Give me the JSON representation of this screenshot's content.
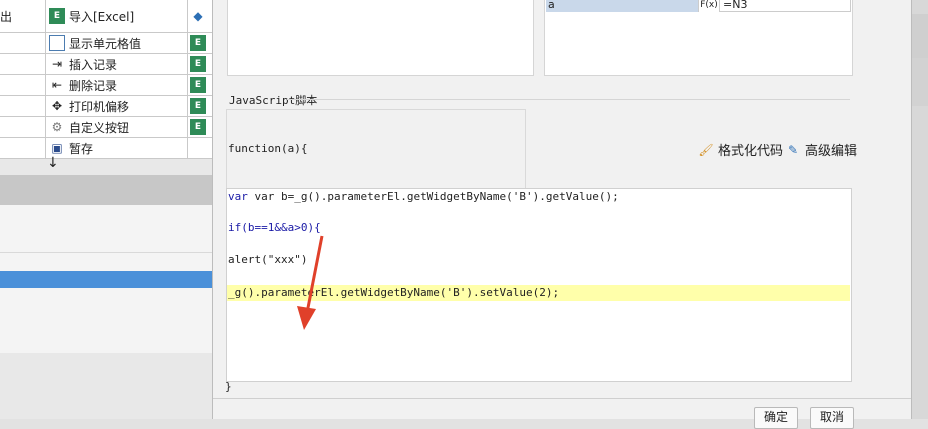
{
  "left_panel": {
    "rows": [
      {
        "c0": "出",
        "c1_icon": "import-excel-icon",
        "c1": "导入[Excel]",
        "c2": ""
      },
      {
        "c0": "",
        "c1_icon": "show-cell-icon",
        "c1": "显示单元格值",
        "c2": ""
      },
      {
        "c0": "",
        "c1_icon": "insert-record-icon",
        "c1": "插入记录",
        "c2": ""
      },
      {
        "c0": "",
        "c1_icon": "delete-record-icon",
        "c1": "删除记录",
        "c2": ""
      },
      {
        "c0": "",
        "c1_icon": "printer-offset-icon",
        "c1": "打印机偏移",
        "c2": ""
      },
      {
        "c0": "",
        "c1_icon": "gear-icon",
        "c1": "自定义按钮",
        "c2": ""
      },
      {
        "c0": "",
        "c1_icon": "save-icon",
        "c1": "暂存",
        "c2": ""
      }
    ]
  },
  "parameter_table": {
    "name": "a",
    "type": "F(x)",
    "value": "=N3"
  },
  "js_section": {
    "title": "JavaScript脚本",
    "signature": "function(a){",
    "format_label": "格式化代码",
    "advanced_label": "高级编辑",
    "closing": "}"
  },
  "code_lines": {
    "l1": "var b=_g().parameterEl.getWidgetByName('B').getValue();",
    "l2": "if(b==1&&a>0){",
    "l3": "alert(\"xxx\")",
    "l4": "_g().parameterEl.getWidgetByName('B').setValue(2);"
  },
  "footer": {
    "ok_label": "确定",
    "cancel_label": "取消"
  },
  "colors": {
    "highlight": "#ffffaa",
    "selection": "#4a90d9",
    "annotation_arrow": "#e0402a"
  }
}
